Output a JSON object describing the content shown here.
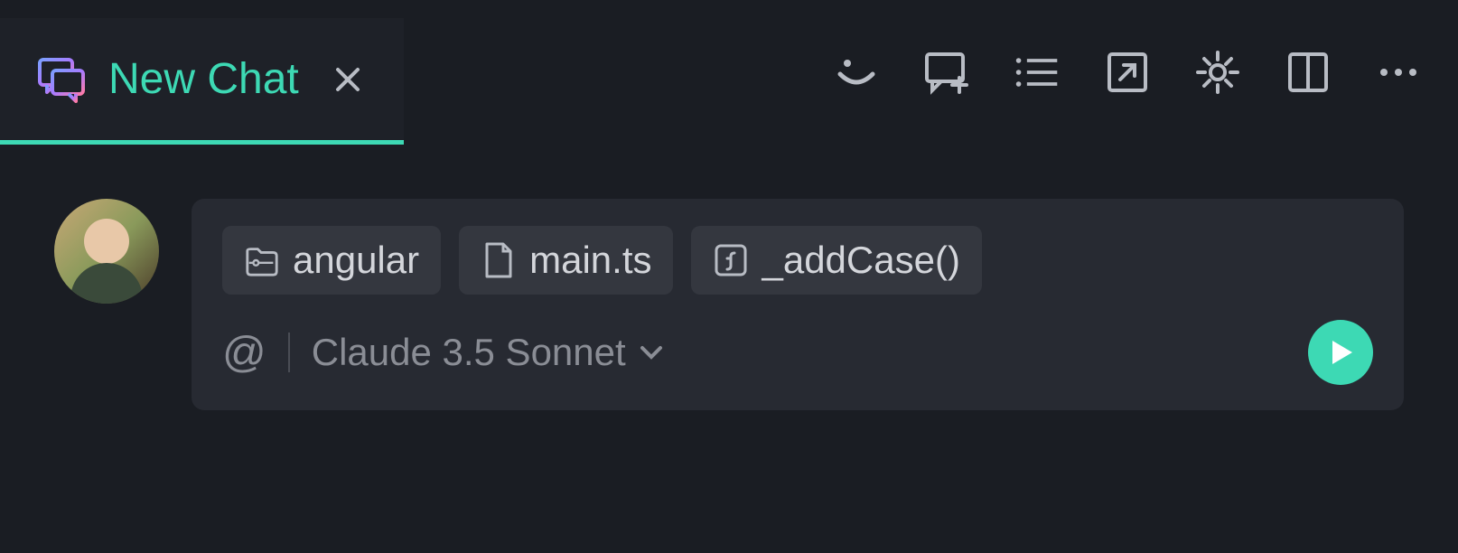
{
  "tab": {
    "title": "New Chat",
    "icon": "chat-icon"
  },
  "toolbar": {
    "icons": [
      "smile-icon",
      "new-chat-icon",
      "list-icon",
      "external-link-icon",
      "settings-icon",
      "split-pane-icon",
      "more-icon"
    ]
  },
  "chat": {
    "chips": [
      {
        "icon": "folder-icon",
        "label": "angular"
      },
      {
        "icon": "file-icon",
        "label": "main.ts"
      },
      {
        "icon": "function-icon",
        "label": "_addCase()"
      }
    ],
    "at_symbol": "@",
    "model": "Claude 3.5 Sonnet"
  },
  "colors": {
    "accent": "#3dd9b4",
    "bg": "#1a1d23",
    "input_bg": "#272a32",
    "chip_bg": "#34373f"
  }
}
